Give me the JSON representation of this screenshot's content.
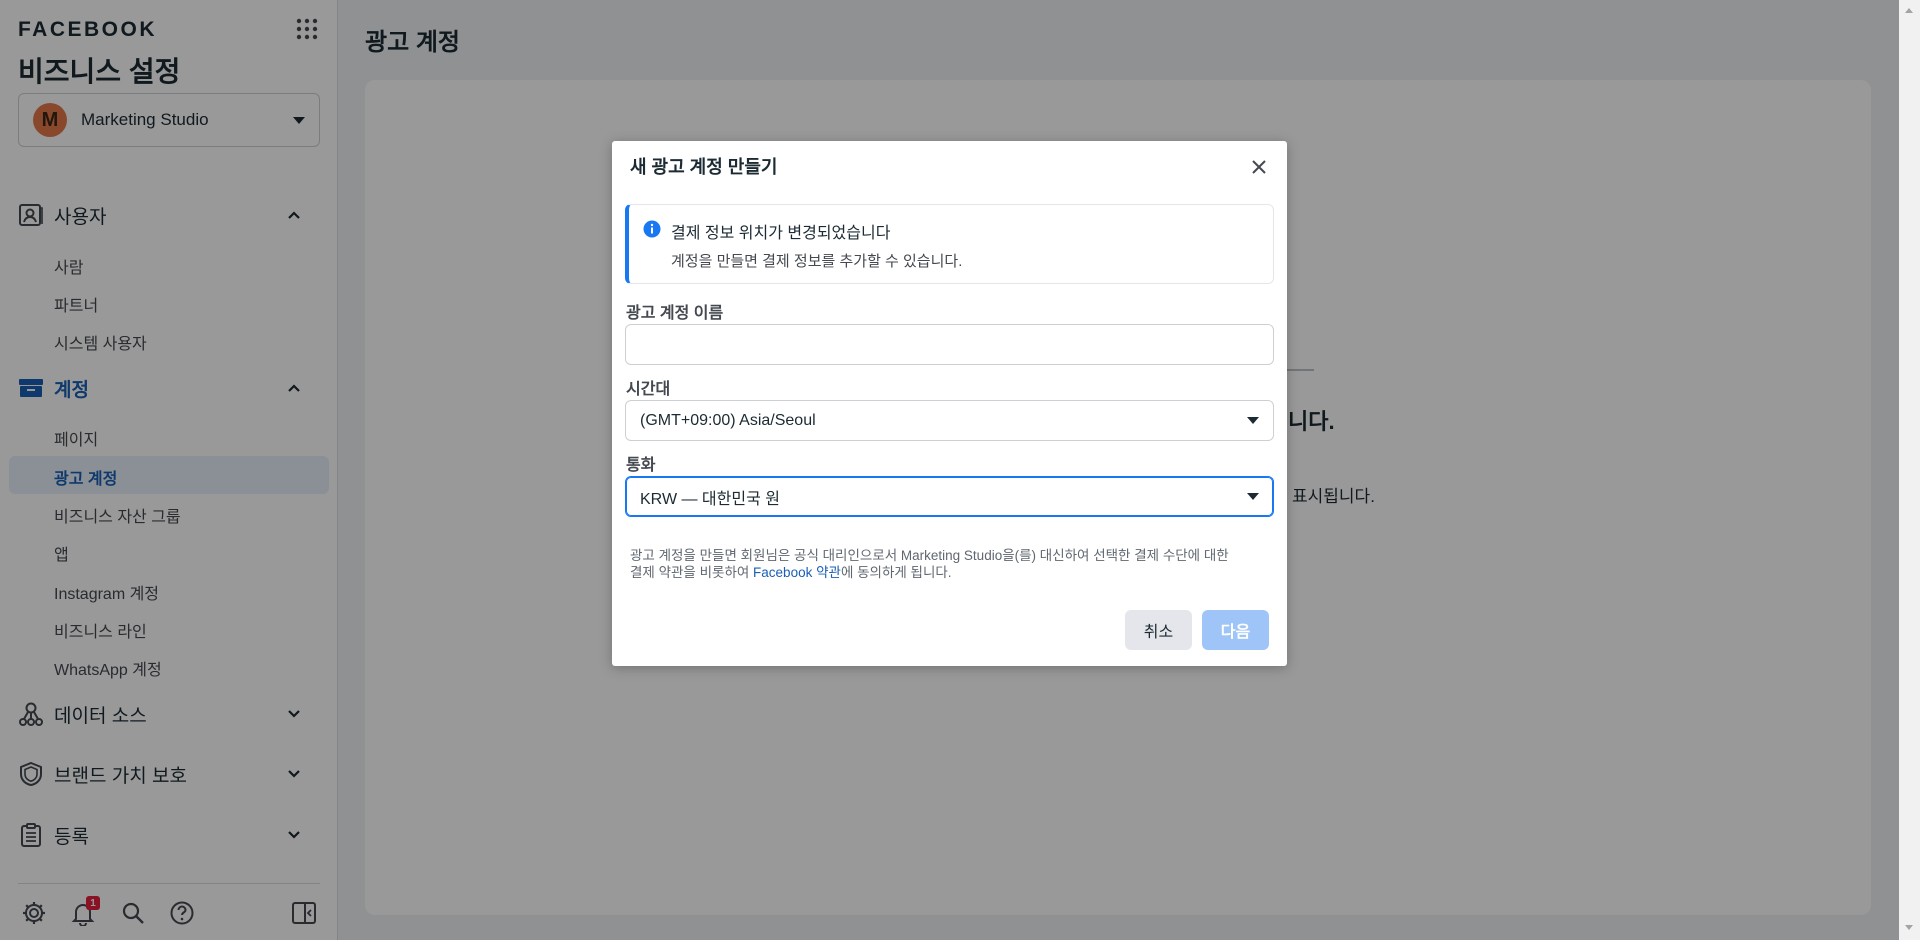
{
  "sidebar": {
    "brand": "FACEBOOK",
    "heading": "비즈니스 설정",
    "business": {
      "initial": "M",
      "name": "Marketing Studio"
    },
    "sections": {
      "users": {
        "label": "사용자",
        "items": [
          "사람",
          "파트너",
          "시스템 사용자"
        ]
      },
      "accounts": {
        "label": "계정",
        "items": [
          "페이지",
          "광고 계정",
          "비즈니스 자산 그룹",
          "앱",
          "Instagram 계정",
          "비즈니스 라인",
          "WhatsApp 계정"
        ],
        "active_item": "광고 계정"
      },
      "data_sources": {
        "label": "데이터 소스"
      },
      "brand_safety": {
        "label": "브랜드 가치 보호"
      },
      "registrations": {
        "label": "등록"
      }
    },
    "footer": {
      "notification_count": "1"
    }
  },
  "main": {
    "title": "광고 계정",
    "card_heading_fragment": "니다.",
    "card_sub_fragment": "표시됩니다."
  },
  "modal": {
    "title": "새 광고 계정 만들기",
    "notice": {
      "title": "결제 정보 위치가 변경되었습니다",
      "body": "계정을 만들면 결제 정보를 추가할 수 있습니다."
    },
    "fields": {
      "account_name": {
        "label": "광고 계정 이름",
        "value": "",
        "placeholder": ""
      },
      "timezone": {
        "label": "시간대",
        "value": "(GMT+09:00) Asia/Seoul"
      },
      "currency": {
        "label": "통화",
        "value": "KRW — 대한민국 원"
      }
    },
    "terms": {
      "line1": "광고 계정을 만들면 회원님은 공식 대리인으로서 Marketing Studio을(를) 대신하여 선택한 결제 수단에 대한",
      "line2_prefix": "결제 약관을 비롯하여 ",
      "link": "Facebook 약관",
      "line2_suffix": "에 동의하게 됩니다."
    },
    "buttons": {
      "cancel": "취소",
      "next": "다음"
    }
  },
  "colors": {
    "accent": "#1877f2",
    "active_nav": "#1a5fb4",
    "disabled_button": "#9fc5f8",
    "avatar": "#e4794a",
    "badge": "#e41e3f"
  },
  "icons": [
    "apps-grid-icon",
    "user-badge-icon",
    "chevron-up-icon",
    "archive-box-icon",
    "data-source-icon",
    "shield-icon",
    "clipboard-icon",
    "chevron-down-icon",
    "gear-icon",
    "bell-icon",
    "search-icon",
    "help-icon",
    "panel-toggle-icon",
    "info-icon",
    "close-icon"
  ]
}
